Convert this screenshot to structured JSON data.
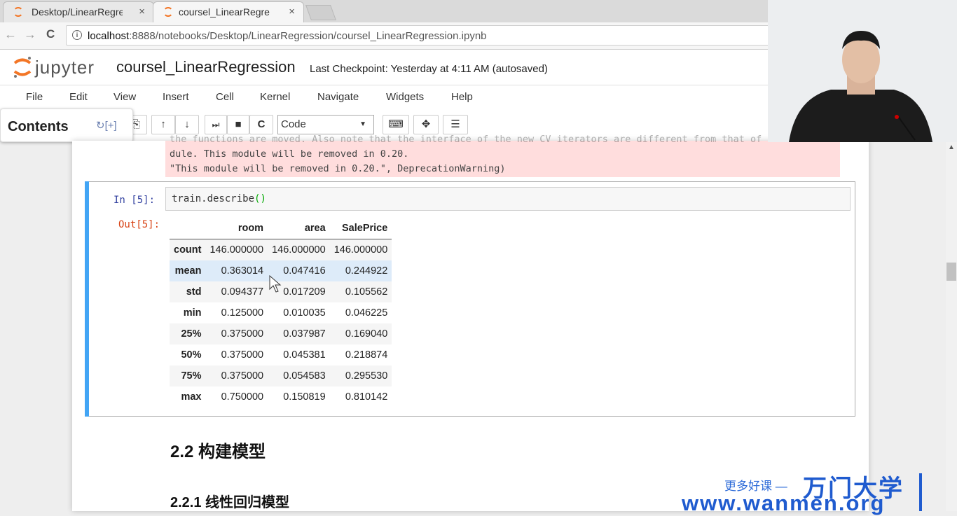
{
  "browser": {
    "tabs": [
      {
        "title": "Desktop/LinearRegress",
        "close": "×"
      },
      {
        "title": "coursel_LinearRegressi",
        "close": "×"
      }
    ],
    "url_host": "localhost",
    "url_rest": ":8888/notebooks/Desktop/LinearRegression/coursel_LinearRegression.ipynb",
    "back": "←",
    "forward": "→",
    "reload": "C",
    "info_icon": "i"
  },
  "jupyter": {
    "logo_text": "jupyter",
    "notebook_name": "coursel_LinearRegression",
    "checkpoint": "Last Checkpoint: Yesterday at 4:11 AM (autosaved)",
    "menu": [
      "File",
      "Edit",
      "View",
      "Insert",
      "Cell",
      "Kernel",
      "Navigate",
      "Widgets",
      "Help"
    ],
    "cell_type": "Code",
    "contents_label": "Contents",
    "contents_tools": "↻[+]"
  },
  "toolbar_icons": {
    "up": "↑",
    "down": "↓",
    "run": "⏭",
    "stop": "■",
    "restart": "C",
    "keyboard": "⌨",
    "crosshair": "✥",
    "list": "☰"
  },
  "stderr": {
    "line0": "the functions are moved. Also note that the interface of the new CV iterators are different from that of this mo",
    "line1": "dule. This module will be removed in 0.20.",
    "line2": "  \"This module will be removed in 0.20.\", DeprecationWarning)"
  },
  "cell": {
    "in_prompt": "In  [5]:",
    "out_prompt": "Out[5]:",
    "code": "train.describe",
    "code_parens": "()"
  },
  "table": {
    "columns": [
      "",
      "room",
      "area",
      "SalePrice"
    ],
    "rows": [
      [
        "count",
        "146.000000",
        "146.000000",
        "146.000000"
      ],
      [
        "mean",
        "0.363014",
        "0.047416",
        "0.244922"
      ],
      [
        "std",
        "0.094377",
        "0.017209",
        "0.105562"
      ],
      [
        "min",
        "0.125000",
        "0.010035",
        "0.046225"
      ],
      [
        "25%",
        "0.375000",
        "0.037987",
        "0.169040"
      ],
      [
        "50%",
        "0.375000",
        "0.045381",
        "0.218874"
      ],
      [
        "75%",
        "0.375000",
        "0.054583",
        "0.295530"
      ],
      [
        "max",
        "0.750000",
        "0.150819",
        "0.810142"
      ]
    ]
  },
  "headings": {
    "h2": "2.2  构建模型",
    "h3": "2.2.1  线性回归模型"
  },
  "watermark": {
    "slogan": "更多好课 —",
    "brand": "万门大学",
    "site": "www.wanmen.org"
  }
}
